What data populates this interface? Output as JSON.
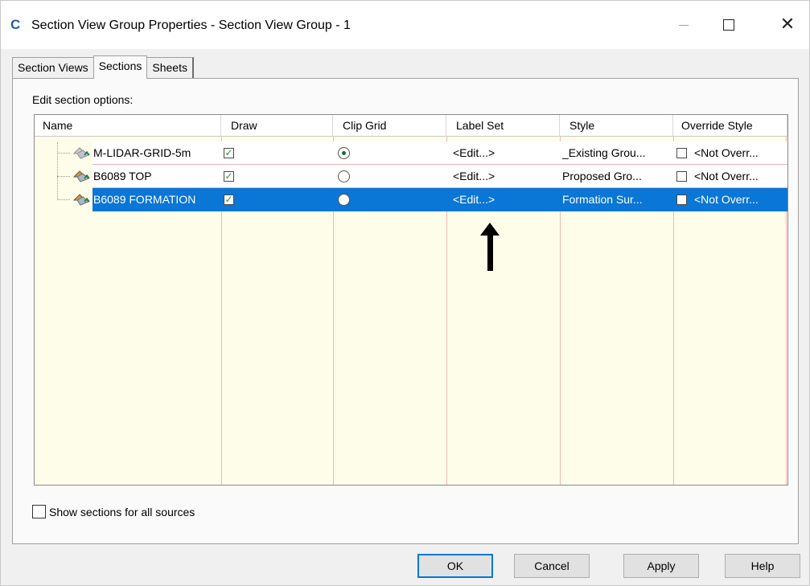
{
  "window": {
    "app_icon_letter": "C",
    "title": "Section View Group Properties - Section View Group - 1"
  },
  "tabs": [
    {
      "label": "Section Views",
      "active": false
    },
    {
      "label": "Sections",
      "active": true
    },
    {
      "label": "Sheets",
      "active": false
    }
  ],
  "section_options_label": "Edit section options:",
  "grid": {
    "columns": [
      "Name",
      "Draw",
      "Clip Grid",
      "Label Set",
      "Style",
      "Override Style"
    ],
    "rows": [
      {
        "name": "M-LIDAR-GRID-5m",
        "draw": true,
        "clip_grid": true,
        "label_set": "<Edit...>",
        "style": "_Existing Grou...",
        "override": false,
        "override_style": "<Not Overr...",
        "selected": false
      },
      {
        "name": "B6089 TOP",
        "draw": true,
        "clip_grid": false,
        "label_set": "<Edit...>",
        "style": "Proposed Gro...",
        "override": false,
        "override_style": "<Not Overr...",
        "selected": false
      },
      {
        "name": "B6089 FORMATION",
        "draw": true,
        "clip_grid": false,
        "label_set": "<Edit...>",
        "style": "Formation Sur...",
        "override": false,
        "override_style": "<Not Overr...",
        "selected": true
      }
    ]
  },
  "show_all_sources": {
    "label": "Show sections for all sources",
    "checked": false
  },
  "buttons": {
    "ok": "OK",
    "cancel": "Cancel",
    "apply": "Apply",
    "help": "Help"
  },
  "colors": {
    "selection": "#0a76d6",
    "grid_background": "#fefde9",
    "check_green": "#2a9a2a"
  }
}
